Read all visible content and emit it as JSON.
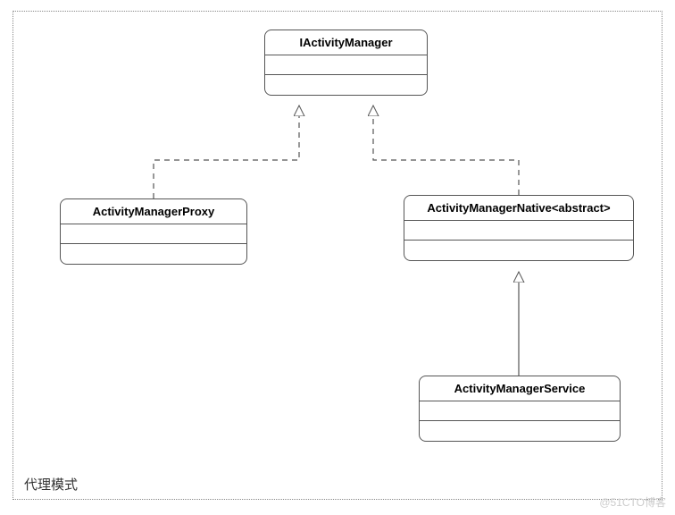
{
  "diagram": {
    "frame_label": "代理模式",
    "classes": {
      "iactivitymanager": {
        "name": "IActivityManager"
      },
      "activitymanagerproxy": {
        "name": "ActivityManagerProxy"
      },
      "activitymanagernative": {
        "name": "ActivityManagerNative<abstract>"
      },
      "activitymanagerservice": {
        "name": "ActivityManagerService"
      }
    },
    "relations": [
      {
        "from": "activitymanagerproxy",
        "to": "iactivitymanager",
        "style": "dashed",
        "arrow": "hollow-triangle",
        "meaning": "realization"
      },
      {
        "from": "activitymanagernative",
        "to": "iactivitymanager",
        "style": "dashed",
        "arrow": "hollow-triangle",
        "meaning": "realization"
      },
      {
        "from": "activitymanagerservice",
        "to": "activitymanagernative",
        "style": "solid",
        "arrow": "hollow-triangle",
        "meaning": "generalization"
      }
    ]
  },
  "watermark": "@51CTO博客"
}
